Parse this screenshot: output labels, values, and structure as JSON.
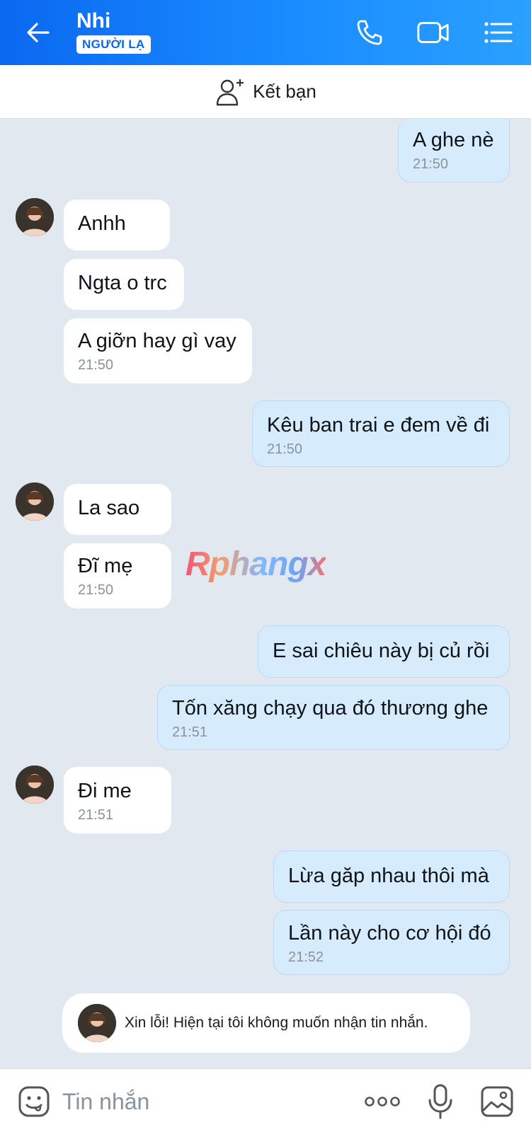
{
  "header": {
    "contact_name": "Nhi",
    "badge": "NGƯỜI LẠ",
    "back_icon": "arrow-left-icon",
    "call_icon": "phone-icon",
    "video_icon": "video-camera-icon",
    "menu_icon": "list-menu-icon"
  },
  "friend_bar": {
    "label": "Kết bạn",
    "icon": "add-user-icon"
  },
  "messages": [
    {
      "dir": "out",
      "text": "A ghe nè",
      "time": "21:50"
    },
    {
      "dir": "in",
      "text": "Anhh",
      "time": ""
    },
    {
      "dir": "in",
      "text": "Ngta o trc",
      "time": ""
    },
    {
      "dir": "in",
      "text": "A giỡn hay gì vay",
      "time": "21:50"
    },
    {
      "dir": "out",
      "text": "Kêu ban trai e đem về đi",
      "time": "21:50"
    },
    {
      "dir": "in",
      "text": "La sao",
      "time": ""
    },
    {
      "dir": "in",
      "text": "Đĩ mẹ",
      "time": "21:50"
    },
    {
      "dir": "out",
      "text": "E sai chiêu này bị củ rồi",
      "time": ""
    },
    {
      "dir": "out",
      "text": "Tốn xăng chạy qua đó thương ghe",
      "time": "21:51"
    },
    {
      "dir": "in",
      "text": "Đi me",
      "time": "21:51"
    },
    {
      "dir": "out",
      "text": "Lừa găp nhau thôi mà",
      "time": ""
    },
    {
      "dir": "out",
      "text": "Lần này cho cơ hội đó",
      "time": "21:52"
    }
  ],
  "watermark": "Rphangx",
  "notice": "Xin lỗi! Hiện tại tôi không muốn nhận tin nhắn.",
  "input_bar": {
    "placeholder": "Tin nhắn",
    "icons": [
      "emoji-icon",
      "more-dots-icon",
      "microphone-icon",
      "image-icon"
    ]
  },
  "colors": {
    "header": "#1a8cff",
    "incoming_bubble": "#ffffff",
    "outgoing_bubble": "#d6ecfd",
    "chat_background": "#e2e8f0"
  }
}
